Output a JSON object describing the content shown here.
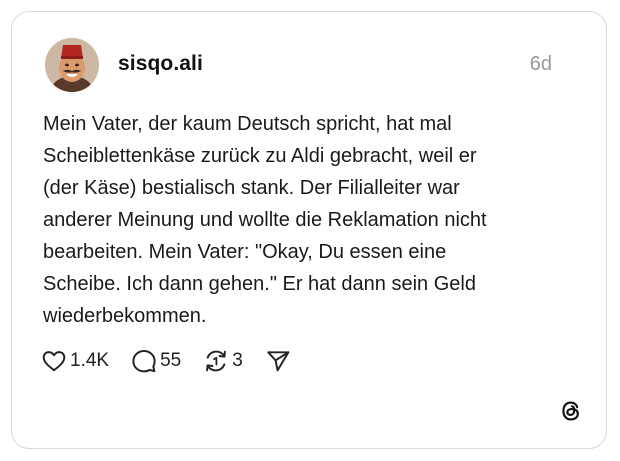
{
  "post": {
    "username": "sisqo.ali",
    "timestamp": "6d",
    "text": "Mein Vater, der kaum Deutsch spricht, hat mal\nScheiblettenkäse zurück zu Aldi gebracht, weil er\n(der Käse) bestialisch stank. Der Filialleiter war\nanderer Meinung und wollte die Reklamation nicht\nbearbeiten. Mein Vater: \"Okay, Du essen eine\nScheibe. Ich dann gehen.\" Er hat dann sein Geld\nwiederbekommen.",
    "avatar_icon": "avatar-man-with-red-fez"
  },
  "actions": {
    "likes": "1.4K",
    "comments": "55",
    "reposts": "3",
    "like_icon": "heart-icon",
    "comment_icon": "comment-bubble-icon",
    "repost_icon": "repost-icon",
    "share_icon": "send-icon"
  },
  "branding": {
    "logo": "threads-logo-icon"
  },
  "colors": {
    "text": "#1a1a1a",
    "muted": "#9a9a9a",
    "border": "#d9d9d9",
    "background": "#ffffff"
  }
}
